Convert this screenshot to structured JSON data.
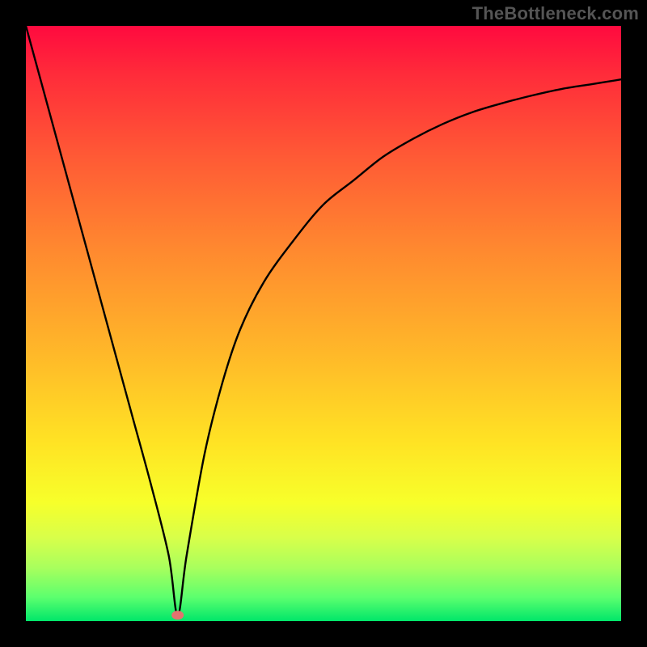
{
  "watermark": "TheBottleneck.com",
  "chart_data": {
    "type": "line",
    "title": "",
    "xlabel": "",
    "ylabel": "",
    "xlim": [
      0,
      100
    ],
    "ylim": [
      0,
      100
    ],
    "grid": false,
    "legend": false,
    "gradient_meaning": "top red = bad / bottom green = good",
    "series": [
      {
        "name": "bottleneck-curve",
        "x": [
          0,
          3,
          6,
          9,
          12,
          15,
          18,
          21,
          24,
          25.5,
          27,
          30,
          33,
          36,
          40,
          45,
          50,
          55,
          60,
          65,
          70,
          75,
          80,
          85,
          90,
          95,
          100
        ],
        "values": [
          100,
          89,
          78,
          67,
          56,
          45,
          34,
          23,
          11,
          1,
          11,
          28,
          40,
          49,
          57,
          64,
          70,
          74,
          78,
          81,
          83.5,
          85.5,
          87,
          88.3,
          89.4,
          90.2,
          91
        ]
      }
    ],
    "marker": {
      "x": 25.5,
      "y": 1,
      "color": "#e2736f"
    }
  }
}
